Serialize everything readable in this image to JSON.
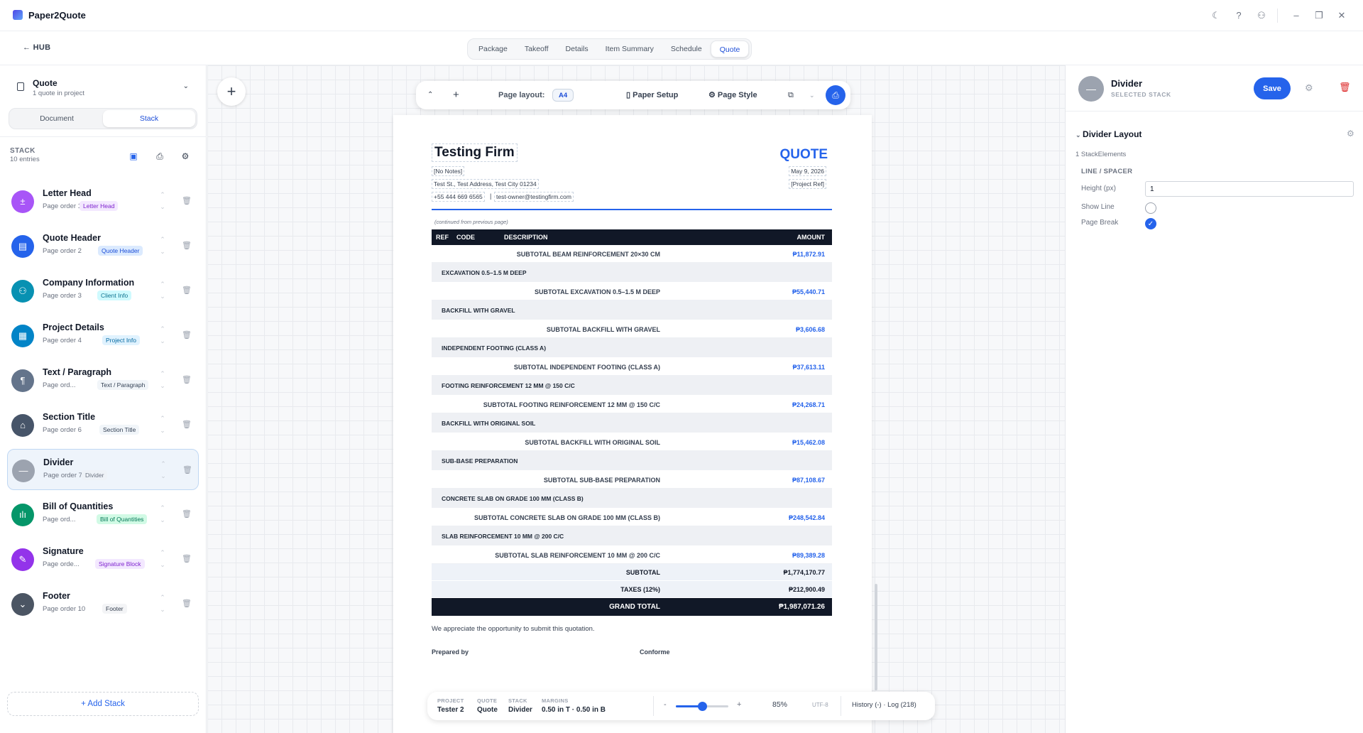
{
  "app": {
    "name": "Paper2Quote"
  },
  "nav": {
    "hub_label": "← HUB",
    "tabs": [
      "Package",
      "Takeoff",
      "Details",
      "Item Summary",
      "Schedule",
      "Quote"
    ],
    "active_tab": "Quote"
  },
  "sidebar": {
    "project_title": "Quote",
    "project_sub": "1 quote in project",
    "modes": [
      "Document",
      "Stack"
    ],
    "active_mode": "Stack",
    "stack_label": "STACK",
    "stack_count": "10 entries",
    "items": [
      {
        "name": "Letter Head",
        "order": "Page order 1",
        "badge": "Letter Head",
        "color": "#a855f7",
        "badge_bg": "#f3e8ff",
        "badge_fg": "#7e22ce",
        "glyph": "±"
      },
      {
        "name": "Quote Header",
        "order": "Page order 2",
        "badge": "Quote Header",
        "color": "#2563eb",
        "badge_bg": "#dbeafe",
        "badge_fg": "#1d4ed8",
        "glyph": "▤"
      },
      {
        "name": "Company Information",
        "order": "Page order 3",
        "badge": "Client Info",
        "color": "#0891b2",
        "badge_bg": "#cffafe",
        "badge_fg": "#0e7490",
        "glyph": "⚇"
      },
      {
        "name": "Project Details",
        "order": "Page order 4",
        "badge": "Project Info",
        "color": "#0284c7",
        "badge_bg": "#e0f2fe",
        "badge_fg": "#0369a1",
        "glyph": "▦"
      },
      {
        "name": "Text / Paragraph",
        "order": "Page ord...",
        "badge": "Text / Paragraph",
        "color": "#64748b",
        "badge_bg": "#f1f5f9",
        "badge_fg": "#334155",
        "glyph": "¶"
      },
      {
        "name": "Section Title",
        "order": "Page order 6",
        "badge": "Section Title",
        "color": "#475569",
        "badge_bg": "#f1f5f9",
        "badge_fg": "#334155",
        "glyph": "⌂"
      },
      {
        "name": "Divider",
        "order": "Page order 7",
        "badge": "Divider",
        "color": "#9ca3af",
        "badge_bg": "#eef2f7",
        "badge_fg": "#6b7280",
        "glyph": "—"
      },
      {
        "name": "Bill of Quantities",
        "order": "Page ord...",
        "badge": "Bill of Quantities",
        "color": "#059669",
        "badge_bg": "#d1fae5",
        "badge_fg": "#047857",
        "glyph": "ılı"
      },
      {
        "name": "Signature",
        "order": "Page orde...",
        "badge": "Signature Block",
        "color": "#9333ea",
        "badge_bg": "#f3e8ff",
        "badge_fg": "#7e22ce",
        "glyph": "✎"
      },
      {
        "name": "Footer",
        "order": "Page order 10",
        "badge": "Footer",
        "color": "#4b5563",
        "badge_bg": "#f3f4f6",
        "badge_fg": "#374151",
        "glyph": "⌄"
      }
    ],
    "selected_index": 6,
    "add_label": "+ Add Stack"
  },
  "toolbar": {
    "page_layout_label": "Page layout:",
    "page_size": "A4",
    "paper_setup": "Paper Setup",
    "page_style": "Page Style"
  },
  "document": {
    "firm_name": "Testing Firm",
    "title": "QUOTE",
    "notes": "[No Notes]",
    "address": "Test St., Test Address, Test City 01234",
    "phone": "+55 444 669 6565",
    "pipe": "|",
    "email": "test-owner@testingfirm.com",
    "date": "May 9, 2026",
    "project_ref": "[Project Ref]",
    "continued": "(continued from previous page)",
    "columns": {
      "ref": "REF",
      "code": "CODE",
      "description": "DESCRIPTION",
      "amount": "AMOUNT"
    },
    "rows": [
      {
        "kind": "sub",
        "text": "SUBTOTAL BEAM REINFORCEMENT 20×30 CM",
        "amount": "₱11,872.91"
      },
      {
        "kind": "grp",
        "text": "EXCAVATION 0.5–1.5 M DEEP"
      },
      {
        "kind": "sub",
        "text": "SUBTOTAL EXCAVATION 0.5–1.5 M DEEP",
        "amount": "₱55,440.71"
      },
      {
        "kind": "grp",
        "text": "BACKFILL WITH GRAVEL"
      },
      {
        "kind": "sub",
        "text": "SUBTOTAL BACKFILL WITH GRAVEL",
        "amount": "₱3,606.68"
      },
      {
        "kind": "grp",
        "text": "INDEPENDENT FOOTING (CLASS A)"
      },
      {
        "kind": "sub",
        "text": "SUBTOTAL INDEPENDENT FOOTING (CLASS A)",
        "amount": "₱37,613.11"
      },
      {
        "kind": "grp",
        "text": "FOOTING REINFORCEMENT 12 MM @ 150 C/C"
      },
      {
        "kind": "sub",
        "text": "SUBTOTAL FOOTING REINFORCEMENT 12 MM @ 150 C/C",
        "amount": "₱24,268.71"
      },
      {
        "kind": "grp",
        "text": "BACKFILL WITH ORIGINAL SOIL"
      },
      {
        "kind": "sub",
        "text": "SUBTOTAL BACKFILL WITH ORIGINAL SOIL",
        "amount": "₱15,462.08"
      },
      {
        "kind": "grp",
        "text": "SUB-BASE PREPARATION"
      },
      {
        "kind": "sub",
        "text": "SUBTOTAL SUB-BASE PREPARATION",
        "amount": "₱87,108.67"
      },
      {
        "kind": "grp",
        "text": "CONCRETE SLAB ON GRADE 100 MM (CLASS B)"
      },
      {
        "kind": "sub",
        "text": "SUBTOTAL CONCRETE SLAB ON GRADE 100 MM (CLASS B)",
        "amount": "₱248,542.84"
      },
      {
        "kind": "grp",
        "text": "SLAB REINFORCEMENT 10 MM @ 200 C/C"
      },
      {
        "kind": "sub",
        "text": "SUBTOTAL SLAB REINFORCEMENT 10 MM @ 200 C/C",
        "amount": "₱89,389.28"
      },
      {
        "kind": "tot",
        "text": "SUBTOTAL",
        "amount": "₱1,774,170.77"
      },
      {
        "kind": "tot",
        "text": "TAXES (12%)",
        "amount": "₱212,900.49"
      },
      {
        "kind": "grand",
        "text": "GRAND TOTAL",
        "amount": "₱1,987,071.26"
      }
    ],
    "appreciation": "We appreciate the opportunity to submit this quotation.",
    "prepared_by": "Prepared by",
    "conforme": "Conforme"
  },
  "status": {
    "project_k": "PROJECT",
    "project_v": "Tester 2",
    "quote_k": "QUOTE",
    "quote_v": "Quote",
    "stack_k": "STACK",
    "stack_v": "Divider",
    "margins_k": "MARGINS",
    "margins_v": "0.50 in T · 0.50 in B",
    "zoom_minus": "-",
    "zoom_plus": "+",
    "zoom_fraction": 0.5,
    "zoom": "85%",
    "encoding": "UTF-8",
    "history": "History (-) · Log (218)"
  },
  "inspector": {
    "title": "Divider",
    "subtitle": "SELECTED STACK",
    "save_label": "Save",
    "section": "Divider Layout",
    "elements": "1 StackElements",
    "group": "LINE / SPACER",
    "height_label": "Height (px)",
    "height_value": "1",
    "show_line_label": "Show Line",
    "show_line": false,
    "page_break_label": "Page Break",
    "page_break": true
  }
}
